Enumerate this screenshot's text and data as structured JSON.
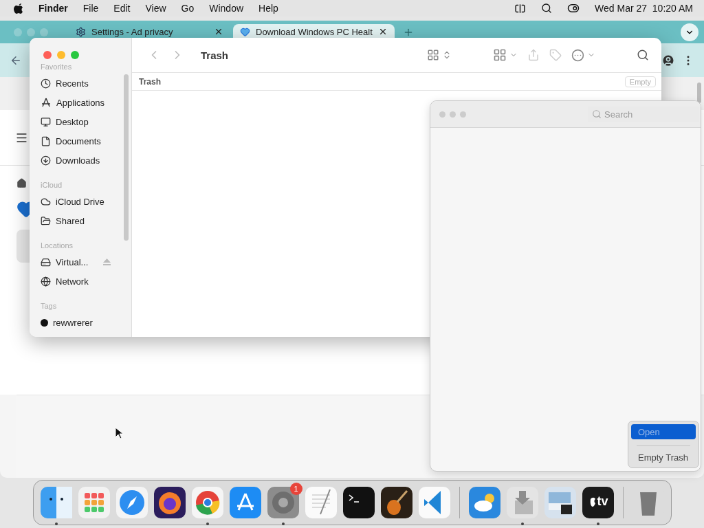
{
  "menu_bar": {
    "app": "Finder",
    "menus": [
      "File",
      "Edit",
      "View",
      "Go",
      "Window",
      "Help"
    ],
    "clock": "Wed Mar 27  10:20 AM"
  },
  "browser": {
    "tabs": [
      {
        "title": "Settings - Ad privacy",
        "selected": false
      },
      {
        "title": "Download Windows PC Healt",
        "selected": true
      }
    ]
  },
  "finder": {
    "title": "Trash",
    "path_label": "Trash",
    "empty_button": "Empty",
    "sections": [
      {
        "heading": "Favorites",
        "items": [
          {
            "label": "Recents"
          },
          {
            "label": "Applications"
          },
          {
            "label": "Desktop"
          },
          {
            "label": "Documents"
          },
          {
            "label": "Downloads"
          }
        ]
      },
      {
        "heading": "iCloud",
        "items": [
          {
            "label": "iCloud Drive"
          },
          {
            "label": "Shared"
          }
        ]
      },
      {
        "heading": "Locations",
        "items": [
          {
            "label": "Virtual...",
            "eject": true
          },
          {
            "label": "Network"
          }
        ]
      },
      {
        "heading": "Tags",
        "items": [
          {
            "label": "rewwrerer",
            "color": "#111111"
          }
        ]
      }
    ]
  },
  "empty_window": {
    "search_placeholder": "Search"
  },
  "context_menu": [
    {
      "label": "Open",
      "selected": true
    },
    {
      "label": "Empty Trash",
      "selected": false
    }
  ],
  "dock": [
    {
      "kind": "finder",
      "running": true
    },
    {
      "kind": "launchpad",
      "running": false
    },
    {
      "kind": "safari",
      "running": false
    },
    {
      "kind": "firefox",
      "running": false
    },
    {
      "kind": "chrome",
      "running": true
    },
    {
      "kind": "appstore",
      "running": false
    },
    {
      "kind": "settings",
      "running": true,
      "badge": "1"
    },
    {
      "kind": "textedit",
      "running": false
    },
    {
      "kind": "terminal",
      "running": false
    },
    {
      "kind": "guitar",
      "running": false
    },
    {
      "kind": "vscode",
      "running": false
    },
    {
      "kind": "separator"
    },
    {
      "kind": "weather",
      "running": false
    },
    {
      "kind": "downloads",
      "running": true
    },
    {
      "kind": "preview",
      "running": false
    },
    {
      "kind": "tv",
      "running": true,
      "label": "tv"
    },
    {
      "kind": "separator"
    },
    {
      "kind": "trash",
      "running": false
    }
  ]
}
